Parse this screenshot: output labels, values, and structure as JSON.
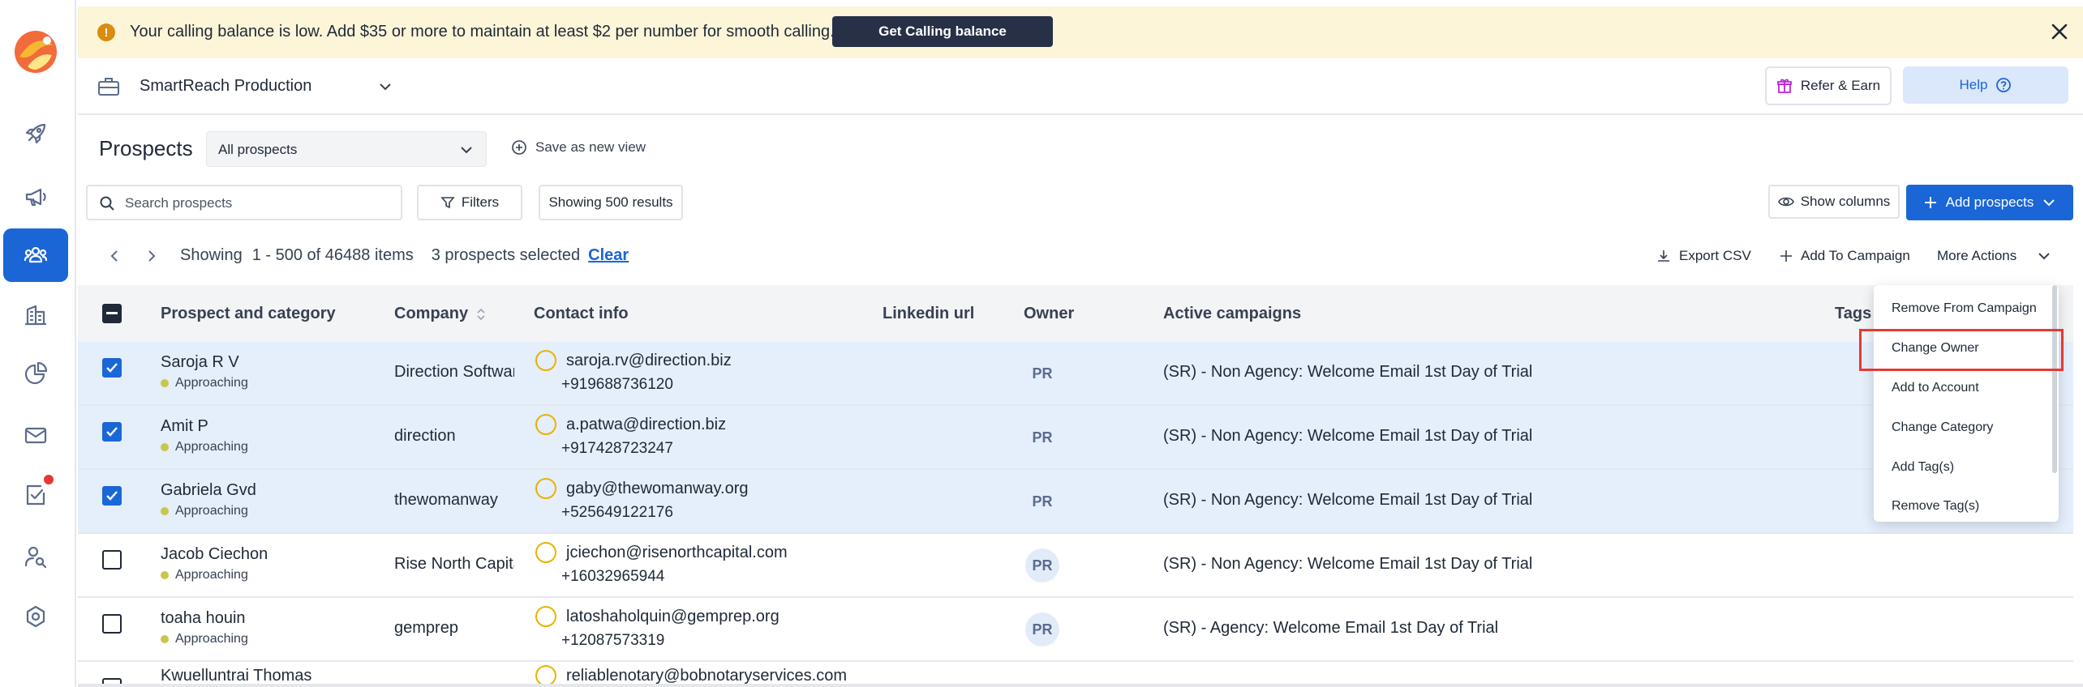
{
  "banner": {
    "message": "Your calling balance is low. Add $35 or more to maintain at least $2 per number for smooth calling.",
    "cta": "Get Calling balance"
  },
  "header": {
    "workspace": "SmartReach Production",
    "refer": "Refer & Earn",
    "help": "Help"
  },
  "toolbar": {
    "title": "Prospects",
    "view": "All prospects",
    "save_view": "Save as new view",
    "search_placeholder": "Search prospects",
    "filters": "Filters",
    "results": "Showing 500 results",
    "show_columns": "Show columns",
    "add_prospects": "Add prospects"
  },
  "pager": {
    "showing": "Showing",
    "range": "1 - 500 of 46488 items",
    "selected": "3 prospects selected",
    "clear": "Clear"
  },
  "actions": {
    "export": "Export CSV",
    "add_campaign": "Add To Campaign",
    "more": "More Actions"
  },
  "columns": {
    "prospect": "Prospect and category",
    "company": "Company",
    "contact": "Contact info",
    "linkedin": "Linkedin url",
    "owner": "Owner",
    "campaigns": "Active campaigns",
    "tags": "Tags"
  },
  "rows": [
    {
      "name": "Saroja R V",
      "category": "Approaching",
      "company": "Direction Softwar",
      "email": "saroja.rv@direction.biz",
      "phone": "+919688736120",
      "owner": "PR",
      "campaign": "(SR) - Non Agency: Welcome Email 1st Day of Trial",
      "selected": true
    },
    {
      "name": "Amit P",
      "category": "Approaching",
      "company": "direction",
      "email": "a.patwa@direction.biz",
      "phone": "+917428723247",
      "owner": "PR",
      "campaign": "(SR) - Non Agency: Welcome Email 1st Day of Trial",
      "selected": true
    },
    {
      "name": "Gabriela Gvd",
      "category": "Approaching",
      "company": "thewomanway",
      "email": "gaby@thewomanway.org",
      "phone": "+525649122176",
      "owner": "PR",
      "campaign": "(SR) - Non Agency: Welcome Email 1st Day of Trial",
      "selected": true
    },
    {
      "name": "Jacob Ciechon",
      "category": "Approaching",
      "company": "Rise North Capita",
      "email": "jciechon@risenorthcapital.com",
      "phone": "+16032965944",
      "owner": "PR",
      "campaign": "(SR) - Non Agency: Welcome Email 1st Day of Trial",
      "selected": false
    },
    {
      "name": "toaha houin",
      "category": "Approaching",
      "company": "gemprep",
      "email": "latoshaholquin@gemprep.org",
      "phone": "+12087573319",
      "owner": "PR",
      "campaign": "(SR) - Agency: Welcome Email 1st Day of Trial",
      "selected": false
    },
    {
      "name": "Kwuelluntrai Thomas",
      "category": "",
      "company": "",
      "email": "reliablenotary@bobnotaryservices.com",
      "phone": "",
      "owner": "",
      "campaign": "",
      "selected": false
    }
  ],
  "menu": {
    "items": [
      "Remove From Campaign",
      "Change Owner",
      "Add to Account",
      "Change Category",
      "Add Tag(s)",
      "Remove Tag(s)"
    ]
  },
  "colors": {
    "primary": "#1a66d6",
    "banner_bg": "#fdf5d8",
    "highlight": "#e53935",
    "selected_row": "#e5eefb"
  }
}
